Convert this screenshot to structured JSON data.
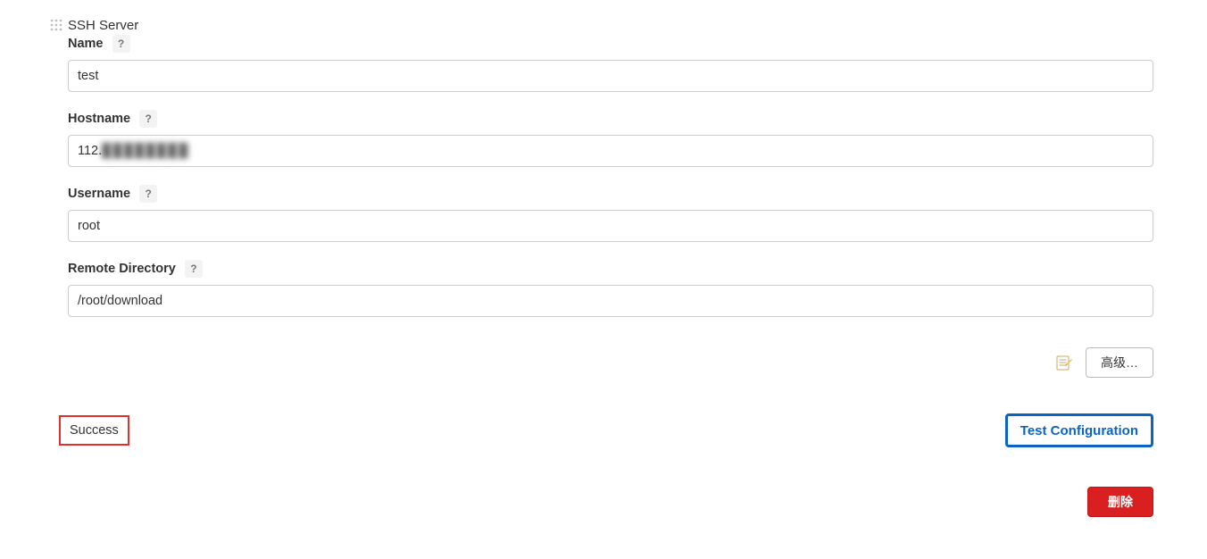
{
  "section": {
    "title": "SSH Server"
  },
  "fields": {
    "name": {
      "label": "Name",
      "value": "test",
      "help": "?"
    },
    "hostname": {
      "label": "Hostname",
      "visible_prefix": "112.",
      "redacted": true,
      "help": "?"
    },
    "username": {
      "label": "Username",
      "value": "root",
      "help": "?"
    },
    "remote": {
      "label": "Remote Directory",
      "value": "/root/download",
      "help": "?"
    }
  },
  "buttons": {
    "advanced": "高级…",
    "test": "Test Configuration",
    "delete": "删除"
  },
  "status": {
    "success_label": "Success"
  },
  "icons": {
    "drag_handle": "drag-handle-icon",
    "notepad": "notepad-icon"
  }
}
